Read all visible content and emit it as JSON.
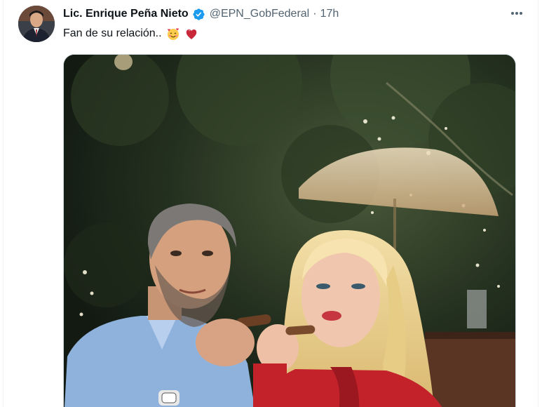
{
  "tweet": {
    "author_name": "Lic. Enrique Peña Nieto",
    "handle": "@EPN_GobFederal",
    "separator": "·",
    "time": "17h",
    "text": "Fan de su relación..",
    "emojis": [
      "smiling-face-with-hearts",
      "red-heart"
    ]
  },
  "icons": {
    "verified": "verified-badge-icon",
    "more": "more-options-icon"
  },
  "colors": {
    "name": "#0f1419",
    "secondary": "#536471",
    "verified": "#1d9bf0",
    "border": "#cfd9de",
    "dress": "#c3222a",
    "shirt": "#8fb2dc"
  }
}
